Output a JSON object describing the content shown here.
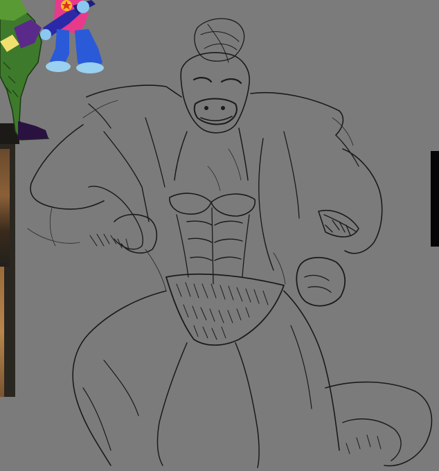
{
  "artwork": {
    "subject": "",
    "background_color": "#7b7b7b",
    "sketch_stroke_color": "#1a1a1a",
    "reference_character_colors": {
      "green_gator": "#3e7a2c",
      "purple_accent": "#5a2a8a",
      "blue_rabbit": "#2a5ad8",
      "pink_accent": "#e83a8a",
      "star": "#f0c020"
    }
  },
  "icons": {
    "reference_image": "reference-character-icon",
    "sketch": "pencil-sketch-drawing"
  }
}
